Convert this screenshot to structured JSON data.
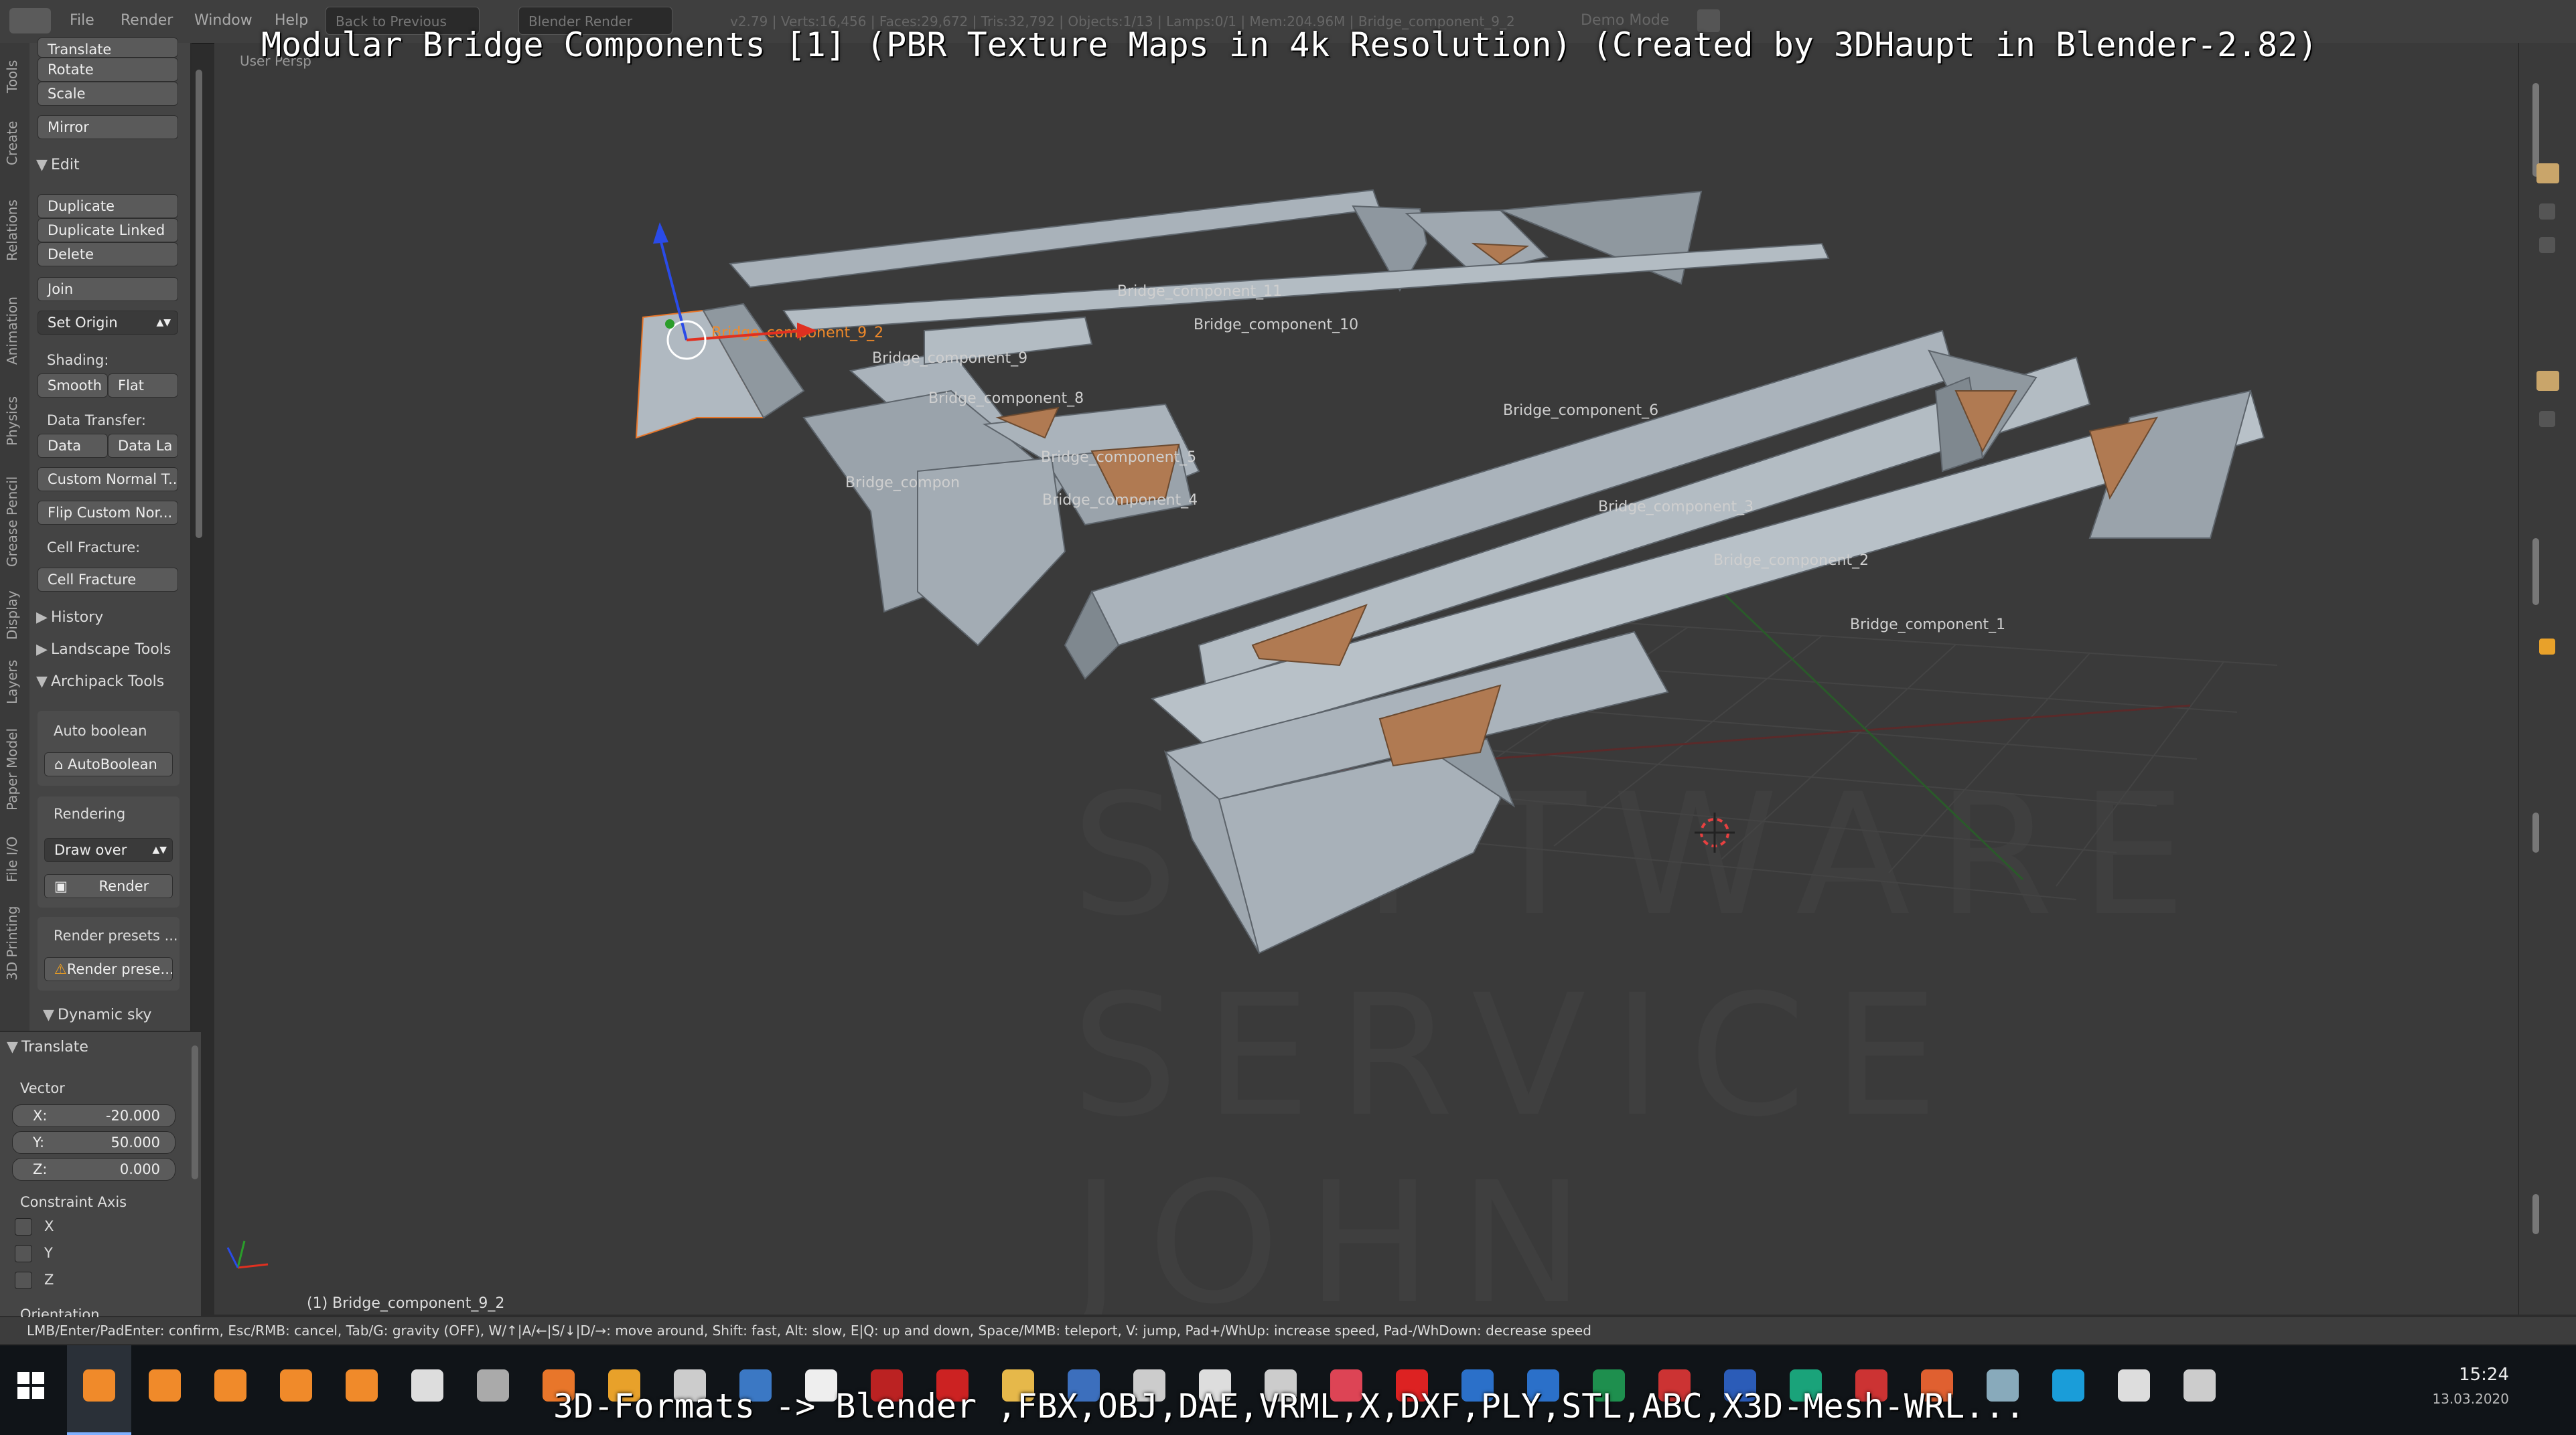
{
  "header": {
    "menus": [
      "File",
      "Render",
      "Window",
      "Help"
    ],
    "back_button": "Back to Previous",
    "render_engine": "Blender Render",
    "stats": "v2.79 | Verts:16,456 | Faces:29,672 | Tris:32,792 | Objects:1/13 | Lamps:0/1 | Mem:204.96M | Bridge_component_9_2",
    "mode": "Demo Mode"
  },
  "overlay": {
    "title": "Modular Bridge Components [1] (PBR Texture Maps in 4k Resolution) (Created by 3DHaupt in Blender-2.82)",
    "formats": "3D-Formats -> Blender ,FBX,OBJ,DAE,VRML,X,DXF,PLY,STL,ABC,X3D-Mesh-WRL..."
  },
  "vertical_tabs": [
    "Tools",
    "Create",
    "Relations",
    "Animation",
    "Physics",
    "Grease Pencil",
    "Display",
    "Layers",
    "Paper Model",
    "File I/O",
    "3D Printing"
  ],
  "toolshelf": {
    "translate_top": "Translate",
    "rotate": "Rotate",
    "scale": "Scale",
    "mirror": "Mirror",
    "edit_header": "Edit",
    "duplicate": "Duplicate",
    "duplicate_linked": "Duplicate Linked",
    "delete": "Delete",
    "join": "Join",
    "set_origin": "Set Origin",
    "shading_label": "Shading:",
    "smooth": "Smooth",
    "flat": "Flat",
    "data_transfer_label": "Data Transfer:",
    "data": "Data",
    "data_la": "Data La",
    "custom_normal": "Custom Normal T...",
    "flip_custom": "Flip Custom Nor...",
    "cell_fracture_label": "Cell Fracture:",
    "cell_fracture": "Cell Fracture",
    "history": "History",
    "landscape_tools": "Landscape Tools",
    "archipack_tools": "Archipack Tools",
    "auto_boolean_label": "Auto boolean",
    "autoboolean": "AutoBoolean",
    "rendering_label": "Rendering",
    "draw_over": "Draw over",
    "render": "Render",
    "render_presets_label": "Render presets ...",
    "render_presets_btn": "Render prese...",
    "dynamic_sky": "Dynamic sky"
  },
  "operator_panel": {
    "header": "Translate",
    "vector_label": "Vector",
    "x_label": "X:",
    "x_value": "-20.000",
    "y_label": "Y:",
    "y_value": "50.000",
    "z_label": "Z:",
    "z_value": "0.000",
    "constraint_label": "Constraint Axis",
    "axis_x": "X",
    "axis_y": "Y",
    "axis_z": "Z",
    "orientation_label": "Orientation"
  },
  "viewport": {
    "view_name": "User Persp",
    "active_object": "(1) Bridge_component_9_2",
    "labels": {
      "c11": "Bridge_component_11",
      "c10": "Bridge_component_10",
      "c9": "Bridge_component_9",
      "c92": "Bridge_component_9_2",
      "c8": "Bridge_component_8",
      "c7": "Bridge_compon",
      "c5": "Bridge_component_5",
      "c4": "Bridge_component_4",
      "c6": "Bridge_component_6",
      "c3": "Bridge_component_3",
      "c2": "Bridge_component_2",
      "c1": "Bridge_component_1"
    },
    "watermark": [
      "SOFTWARE",
      "SERVICE",
      "JOHN"
    ]
  },
  "statusbar": "LMB/Enter/PadEnter: confirm, Esc/RMB: cancel, Tab/G: gravity (OFF), W/↑|A/←|S/↓|D/→: move around, Shift: fast, Alt: slow, E|Q: up and down, Space/MMB: teleport, V: jump, Pad+/WhUp: increase speed, Pad-/WhDown: decrease speed",
  "taskbar": {
    "time": "15:24",
    "date": "13.03.2020",
    "icon_colors": [
      "#f08a2a",
      "#f08a2a",
      "#f08a2a",
      "#f08a2a",
      "#f08a2a",
      "#ddd",
      "#aaa",
      "#e8762a",
      "#e8a12a",
      "#ccc",
      "#3b78c4",
      "#eee",
      "#b22",
      "#c22",
      "#e6b84a",
      "#3c6fbd",
      "#ccc",
      "#ddd",
      "#ccc",
      "#d45",
      "#d22",
      "#2b70c9",
      "#2b70c9",
      "#1e8f4e",
      "#c33",
      "#2b5cb8",
      "#1aa37a",
      "#c33",
      "#e06030",
      "#8ab",
      "#1a9dd9",
      "#ddd",
      "#ccc"
    ],
    "icon_names": [
      "blender-icon",
      "blender-icon",
      "blender-icon",
      "blender-icon",
      "blender-icon",
      "app-icon",
      "app-icon",
      "firefox-icon",
      "app-icon",
      "terminal-icon",
      "save-icon",
      "app-icon",
      "app-icon",
      "acrobat-icon",
      "folder-icon",
      "app-icon",
      "app-icon",
      "app-icon",
      "app-icon",
      "app-icon",
      "opera-icon",
      "outlook-icon",
      "edge-icon",
      "excel-icon",
      "app-icon",
      "word-icon",
      "publisher-icon",
      "access-icon",
      "app-icon",
      "app-icon",
      "skype-icon",
      "app-icon",
      "app-icon"
    ]
  },
  "colors": {
    "accent": "#f08a2a",
    "selection": "#e8762a",
    "mesh": "#9aa3ab"
  }
}
